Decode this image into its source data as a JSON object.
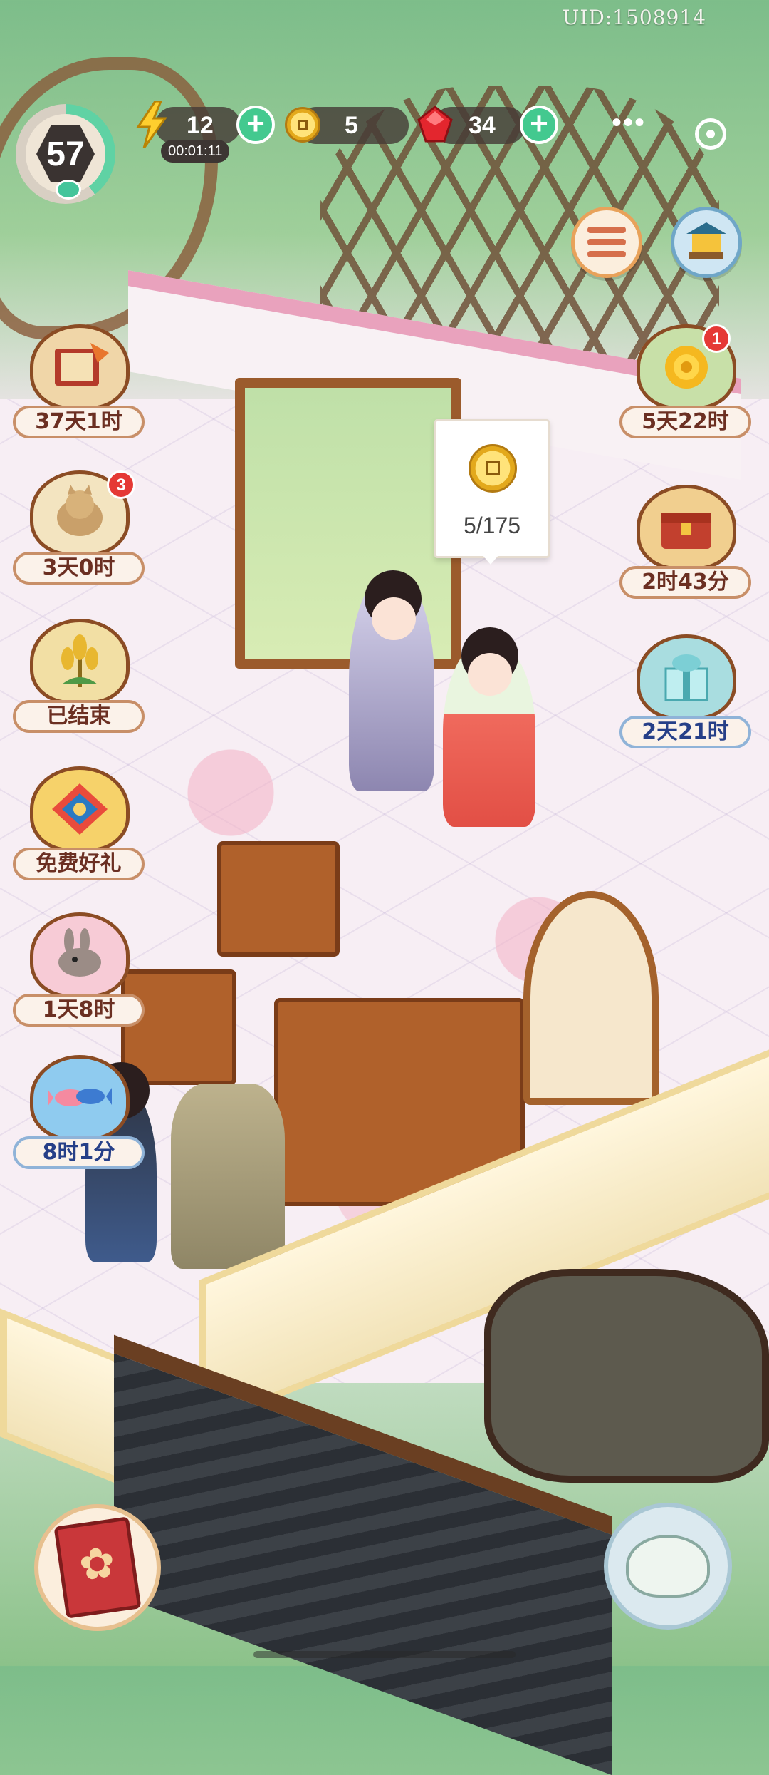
{
  "header": {
    "uid": "UID:1508914",
    "level": "57",
    "energy": {
      "value": "12",
      "timer": "00:01:11",
      "icon": "lightning-icon"
    },
    "coins": {
      "value": "5",
      "icon": "coin-icon"
    },
    "gems": {
      "value": "34",
      "icon": "ruby-icon"
    },
    "plus_symbol": "+",
    "more_symbol": "•••"
  },
  "left_events": [
    {
      "label": "37天1时",
      "icon": "autumn-book-icon"
    },
    {
      "label": "3天0时",
      "icon": "fox-plush-icon",
      "badge": "3"
    },
    {
      "label": "已结束",
      "icon": "wheat-icon"
    },
    {
      "label": "免费好礼",
      "icon": "lucky-pouch-icon"
    },
    {
      "label": "1天8时",
      "icon": "rabbit-icon"
    },
    {
      "label": "8时1分",
      "icon": "koi-fish-icon"
    }
  ],
  "right_events": [
    {
      "label": "5天22时",
      "icon": "chrysanthemum-icon",
      "badge": "1"
    },
    {
      "label": "2时43分",
      "icon": "treasure-chest-icon"
    },
    {
      "label": "2天21时",
      "icon": "gift-box-icon"
    }
  ],
  "tooltip": {
    "text": "5/175",
    "icon": "coin-icon"
  },
  "colors": {
    "event_label_text": "#6b2f22",
    "event_label_blue": "#263f88",
    "plus_green": "#43c98f",
    "badge_red": "#e53935",
    "level_progress": "#5fd2a4"
  },
  "level_progress": 0.4
}
